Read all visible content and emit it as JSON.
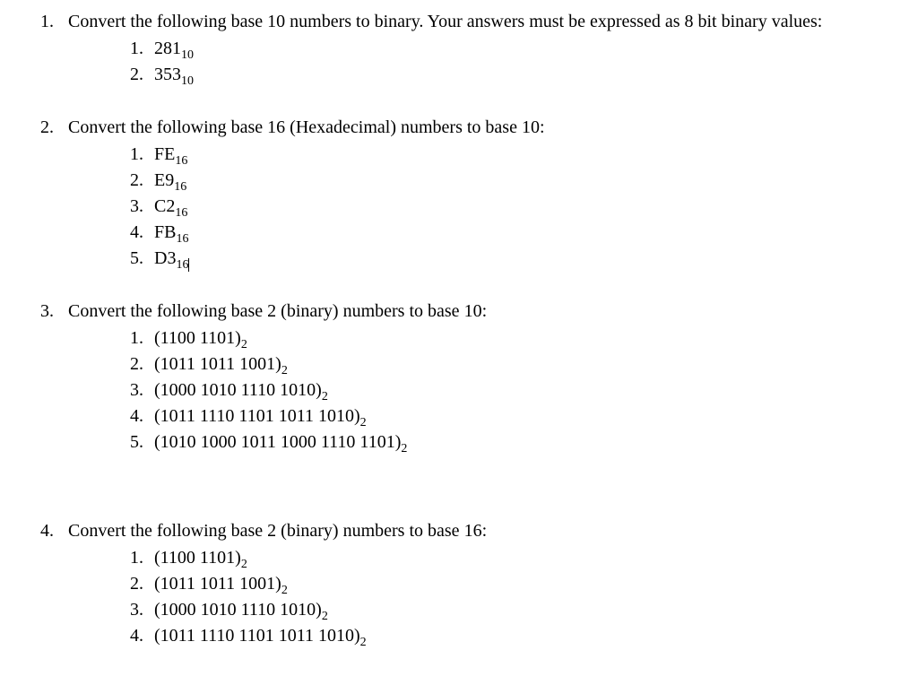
{
  "questions": [
    {
      "number": "1.",
      "text_parts": [
        "Convert the following base 10 numbers to binary. Your answers must be expressed as 8 bit binary values:"
      ],
      "items": [
        {
          "num": "1.",
          "value": "281",
          "sub": "10"
        },
        {
          "num": "2.",
          "value": "353",
          "sub": "10"
        }
      ]
    },
    {
      "number": "2.",
      "text_parts": [
        "Convert the following base 16 (Hexadecimal) numbers to base 10:"
      ],
      "items": [
        {
          "num": "1.",
          "value": "FE",
          "sub": "16"
        },
        {
          "num": "2.",
          "value": "E9",
          "sub": "16"
        },
        {
          "num": "3.",
          "value": "C2",
          "sub": "16"
        },
        {
          "num": "4.",
          "value": "FB",
          "sub": "16"
        },
        {
          "num": "5.",
          "value": "D3",
          "sub": "16",
          "cursor": true
        }
      ]
    },
    {
      "number": "3.",
      "text_parts": [
        "Convert the following base 2 (binary) numbers to base 10:"
      ],
      "items": [
        {
          "num": "1.",
          "value": "(1100 1101)",
          "sub": "2"
        },
        {
          "num": "2.",
          "value": "(1011 1011 1001)",
          "sub": "2"
        },
        {
          "num": "3.",
          "value": "(1000 1010 1110 1010)",
          "sub": "2"
        },
        {
          "num": "4.",
          "value": "(1011 1110 1101 1011 1010)",
          "sub": "2"
        },
        {
          "num": "5.",
          "value": "(1010 1000 1011 1000 1110 1101)",
          "sub": "2"
        }
      ]
    },
    {
      "number": "4.",
      "text_parts": [
        "Convert the following base 2 (binary) numbers to base 16:"
      ],
      "items": [
        {
          "num": "1.",
          "value": "(1100 1101)",
          "sub": "2"
        },
        {
          "num": "2.",
          "value": "(1011 1011 1001)",
          "sub": "2"
        },
        {
          "num": "3.",
          "value": "(1000 1010 1110 1010)",
          "sub": "2"
        },
        {
          "num": "4.",
          "value": "(1011 1110 1101 1011 1010)",
          "sub": "2"
        }
      ]
    }
  ]
}
